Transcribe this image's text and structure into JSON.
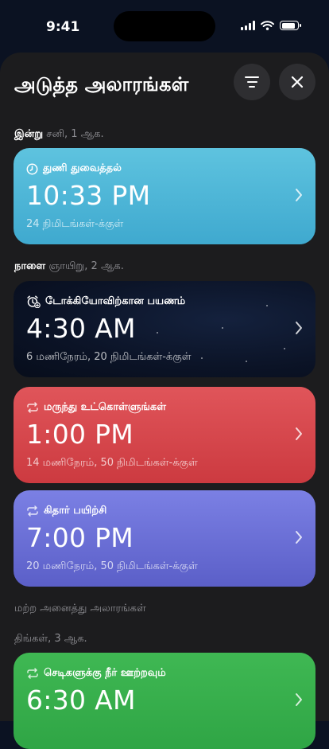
{
  "status_bar": {
    "time": "9:41",
    "battery_level": 0.9
  },
  "sheet": {
    "title": "அடுத்த அலாரங்கள்",
    "filter_icon": "filter-icon",
    "close_icon": "close-icon"
  },
  "sections": {
    "today": {
      "day": "இன்று",
      "date": "சனி, 1 ஆக."
    },
    "tomorrow": {
      "day": "நாளை",
      "date": "ஞாயிறு, 2 ஆக."
    },
    "others": {
      "title": "மற்ற அனைத்து அலாரங்கள்",
      "date": "திங்கள், 3 ஆக."
    }
  },
  "alarms": [
    {
      "label": "துணி துவைத்தல்",
      "time": "10:33 PM",
      "remaining": "24 நிமிடங்கள்-க்குள்",
      "icon": "clock-icon",
      "color": "#4fb8da"
    },
    {
      "label": "டோக்கியோவிற்கான பயணம்",
      "time": "4:30 AM",
      "remaining": "6 மணிநேரம், 20 நிமிடங்கள்-க்குள்",
      "icon": "alarm-clock-add-icon",
      "color": "#0b1326"
    },
    {
      "label": "மருந்து உட்கொள்ளுங்கள்",
      "time": "1:00 PM",
      "remaining": "14 மணிநேரம், 50 நிமிடங்கள்-க்குள்",
      "icon": "repeat-icon",
      "color": "#d64a4f"
    },
    {
      "label": "கிதார் பயிற்சி",
      "time": "7:00 PM",
      "remaining": "20 மணிநேரம், 50 நிமிடங்கள்-க்குள்",
      "icon": "repeat-icon",
      "color": "#6a6fd6"
    },
    {
      "label": "செடிகளுக்கு நீர் ஊற்றவும்",
      "time": "6:30 AM",
      "remaining": "",
      "icon": "repeat-icon",
      "color": "#36ae4c"
    }
  ]
}
